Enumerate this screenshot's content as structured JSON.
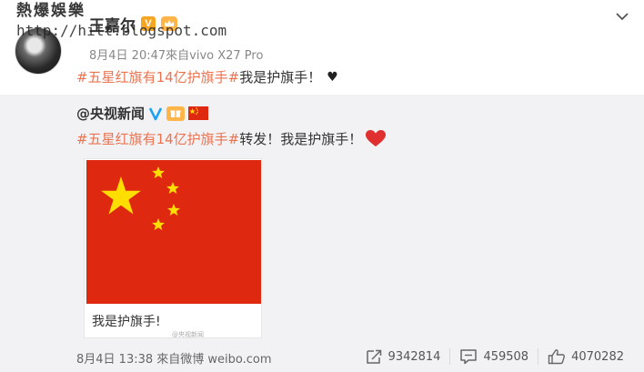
{
  "watermark": {
    "text_cn": "熱爆娛樂",
    "url": "http://hitt.blogspot.com"
  },
  "post": {
    "username": "王嘉尔",
    "badge_v": "V",
    "meta": "8月4日 20:47來自vivo X27 Pro",
    "hashtag": "#五星红旗有14亿护旗手#",
    "text": " 我是护旗手！",
    "heart": "♥"
  },
  "repost": {
    "username": "@央视新闻",
    "hashtag": "#五星红旗有14亿护旗手#",
    "text": "转发！我是护旗手！",
    "card": {
      "caption": "我是护旗手!",
      "mark": "@央视新闻"
    }
  },
  "footer": {
    "meta": "8月4日 13:38 來自微博 weibo.com",
    "shares": "9342814",
    "comments": "459508",
    "likes": "4070282"
  },
  "colors": {
    "hashtag": "#eb7350",
    "flag_red": "#de2910",
    "flag_yellow": "#ffde00",
    "verified_blue": "#1da1f2",
    "repost_bg": "#f2f2f5"
  },
  "icons": [
    "chevron-down-icon",
    "verified-v-icon",
    "crown-icon",
    "blue-v-icon",
    "gift-icon",
    "china-flag-icon",
    "red-heart-icon",
    "share-icon",
    "comment-icon",
    "like-icon"
  ]
}
